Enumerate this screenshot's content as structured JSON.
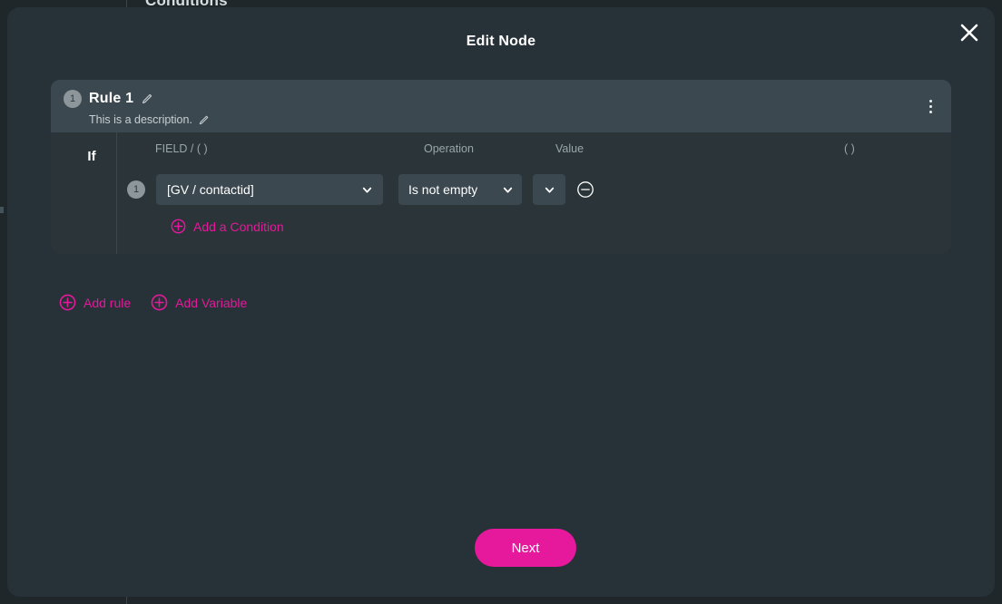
{
  "background": {
    "heading": "Conditions"
  },
  "modal": {
    "title": "Edit Node",
    "close_icon": "close-icon",
    "colors": {
      "accent": "#e6189b",
      "modal_bg": "#273238",
      "card_bg": "#2a3439",
      "card_header_bg": "#3c484f",
      "control_bg": "#3c484f",
      "page_bg": "#1f272b"
    }
  },
  "rule": {
    "number": "1",
    "title": "Rule 1",
    "title_edit_icon": "pencil-icon",
    "description": "This is a description.",
    "description_edit_icon": "pencil-icon",
    "menu_icon": "kebab-menu-icon",
    "if_label": "If",
    "columns": {
      "field": "FIELD / ( )",
      "operation": "Operation",
      "value": "Value",
      "parenthesis": "( )"
    },
    "conditions": [
      {
        "number": "1",
        "field": "[GV / contactid]",
        "operation": "Is not empty",
        "value": "",
        "remove_icon": "minus-circle-icon",
        "chevron_icon": "chevron-down-icon"
      }
    ],
    "add_condition_label": "Add a Condition",
    "add_condition_icon": "plus-circle-icon"
  },
  "actions": {
    "add_rule_label": "Add rule",
    "add_rule_icon": "plus-circle-icon",
    "add_variable_label": "Add Variable",
    "add_variable_icon": "plus-circle-icon"
  },
  "footer": {
    "next_label": "Next"
  }
}
